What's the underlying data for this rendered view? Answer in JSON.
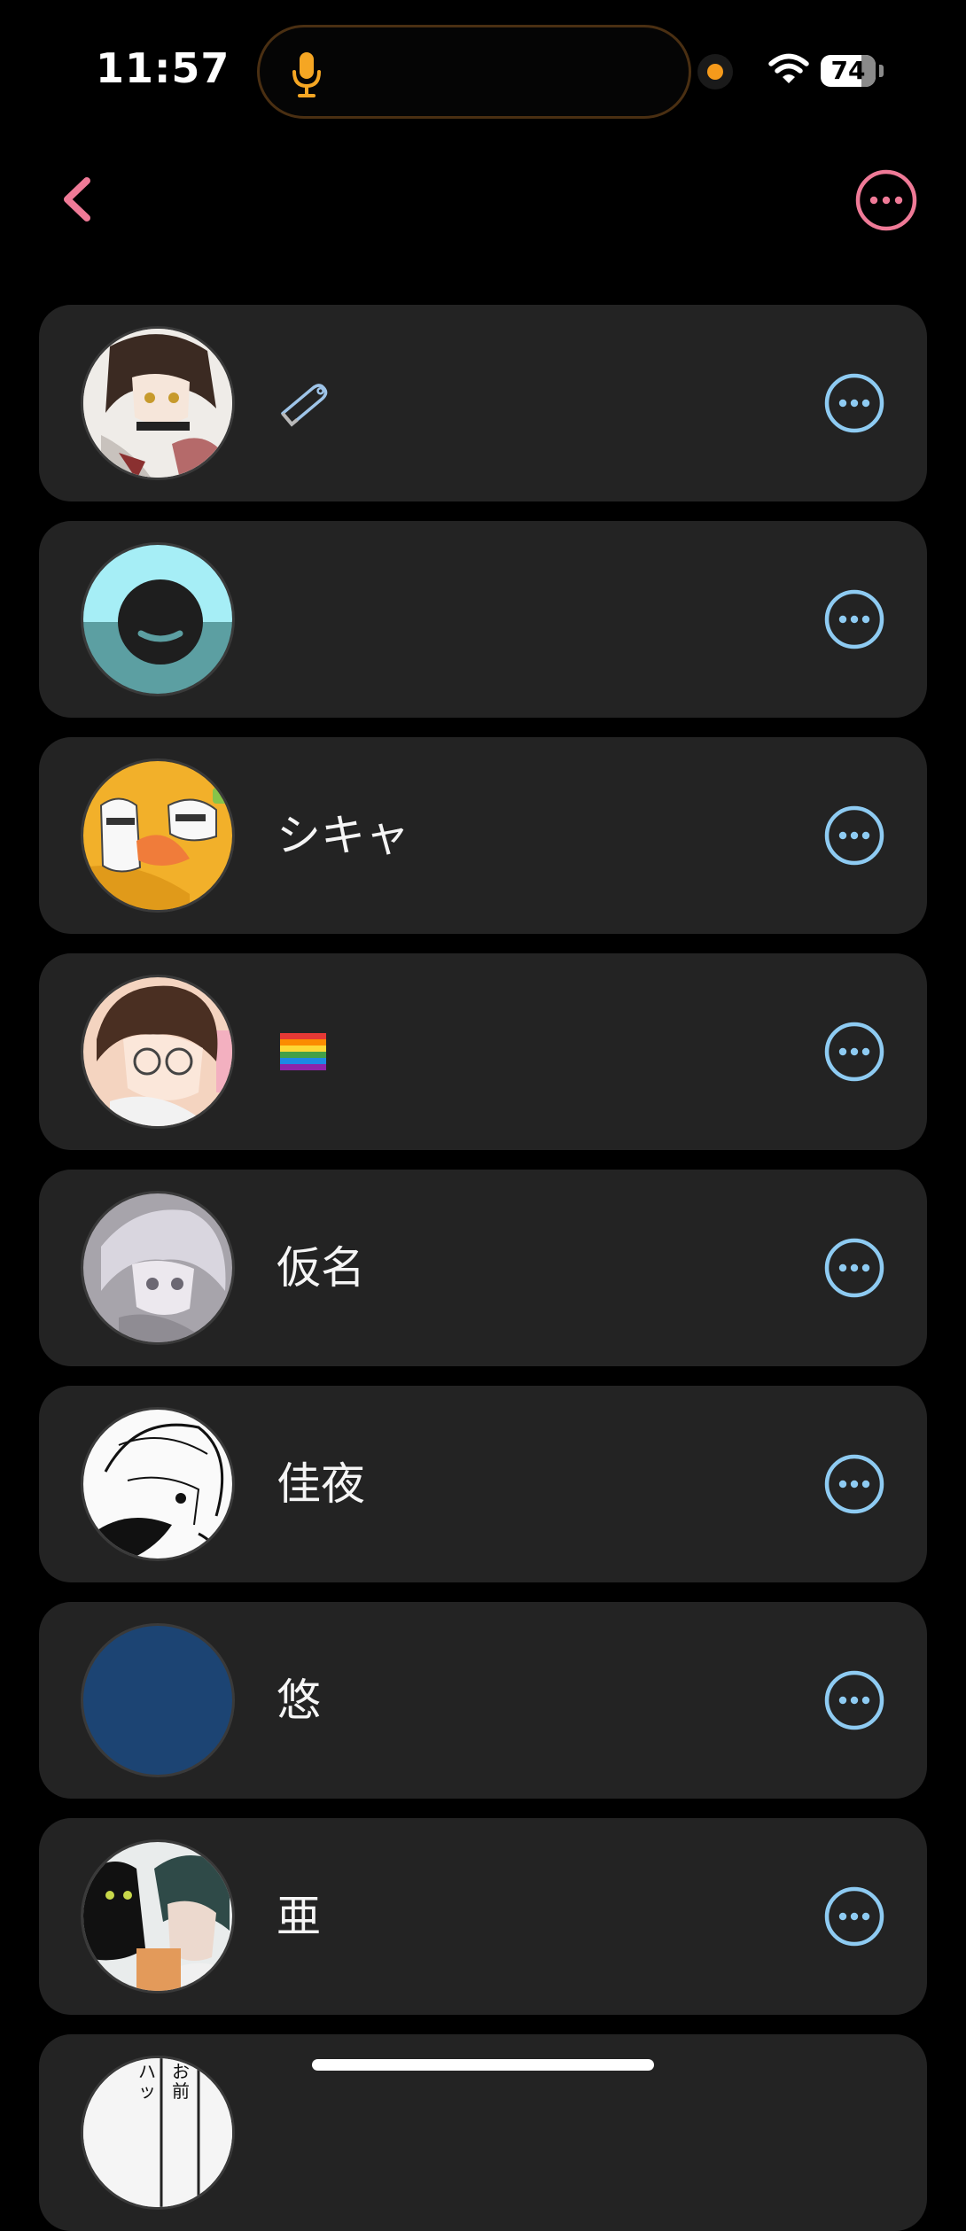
{
  "status_bar": {
    "time": "11:57",
    "battery": "74"
  },
  "accent": "#ef7a97",
  "row_action_color": "#8ecbf2",
  "contacts": [
    {
      "name": "",
      "icon": "safety-pin-icon",
      "avatar": "anime-character-avatar"
    },
    {
      "name": "",
      "icon": "",
      "avatar": "default-smile-avatar"
    },
    {
      "name": "シキャ",
      "icon": "",
      "avatar": "rice-ball-avatar"
    },
    {
      "name": "",
      "icon": "rainbow-flag-icon",
      "avatar": "glasses-character-avatar"
    },
    {
      "name": "仮名",
      "icon": "",
      "avatar": "grey-anime-avatar"
    },
    {
      "name": "佳夜",
      "icon": "",
      "avatar": "manga-lineart-avatar"
    },
    {
      "name": "悠",
      "icon": "",
      "avatar": "blue-avatar"
    },
    {
      "name": "亜",
      "icon": "",
      "avatar": "cat-and-boy-avatar"
    },
    {
      "name": "",
      "icon": "",
      "avatar": "manga-text-avatar",
      "avatar_text": [
        "お",
        "前",
        "ハ",
        "ッ"
      ]
    }
  ]
}
